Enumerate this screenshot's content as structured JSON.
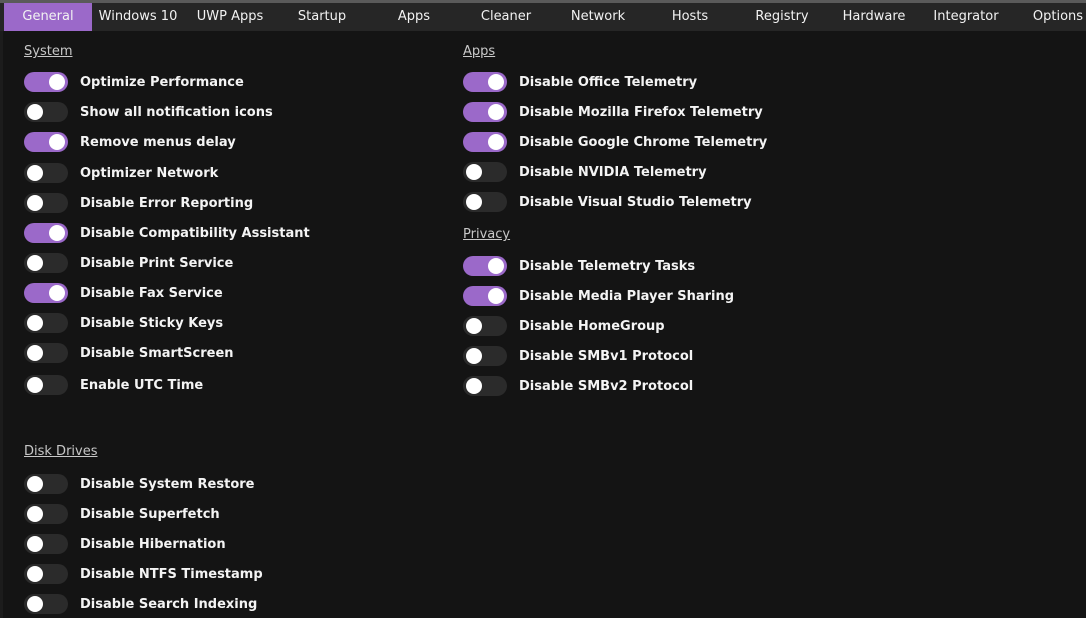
{
  "tabs": [
    {
      "label": "General",
      "active": true
    },
    {
      "label": "Windows 10"
    },
    {
      "label": "UWP Apps"
    },
    {
      "label": "Startup"
    },
    {
      "label": "Apps"
    },
    {
      "label": "Cleaner"
    },
    {
      "label": "Network"
    },
    {
      "label": "Hosts"
    },
    {
      "label": "Registry"
    },
    {
      "label": "Hardware"
    },
    {
      "label": "Integrator"
    },
    {
      "label": "Options"
    }
  ],
  "colors": {
    "accent": "#9b69c9",
    "track_off": "#2b2b2b",
    "background": "#141414"
  },
  "sections": {
    "system": {
      "title": "System",
      "items": [
        {
          "label": "Optimize Performance",
          "on": true
        },
        {
          "label": "Show all notification icons",
          "on": false
        },
        {
          "label": "Remove menus delay",
          "on": true
        },
        {
          "label": "Optimizer Network",
          "on": false
        },
        {
          "label": "Disable Error Reporting",
          "on": false
        },
        {
          "label": "Disable Compatibility Assistant",
          "on": true
        },
        {
          "label": "Disable Print Service",
          "on": false
        },
        {
          "label": "Disable Fax Service",
          "on": true
        },
        {
          "label": "Disable Sticky Keys",
          "on": false
        },
        {
          "label": "Disable SmartScreen",
          "on": false
        },
        {
          "label": "Enable UTC Time",
          "on": false
        }
      ]
    },
    "apps": {
      "title": "Apps",
      "items": [
        {
          "label": "Disable Office Telemetry",
          "on": true
        },
        {
          "label": "Disable Mozilla Firefox Telemetry",
          "on": true
        },
        {
          "label": "Disable Google Chrome Telemetry",
          "on": true
        },
        {
          "label": "Disable NVIDIA Telemetry",
          "on": false
        },
        {
          "label": "Disable Visual Studio Telemetry",
          "on": false
        }
      ]
    },
    "privacy": {
      "title": "Privacy",
      "items": [
        {
          "label": "Disable Telemetry Tasks",
          "on": true
        },
        {
          "label": "Disable Media Player Sharing",
          "on": true
        },
        {
          "label": "Disable HomeGroup",
          "on": false
        },
        {
          "label": "Disable SMBv1 Protocol",
          "on": false
        },
        {
          "label": "Disable SMBv2 Protocol",
          "on": false
        }
      ]
    },
    "disk": {
      "title": "Disk Drives",
      "items": [
        {
          "label": "Disable System Restore",
          "on": false
        },
        {
          "label": "Disable Superfetch",
          "on": false
        },
        {
          "label": "Disable Hibernation",
          "on": false
        },
        {
          "label": "Disable NTFS Timestamp",
          "on": false
        },
        {
          "label": "Disable Search Indexing",
          "on": false
        }
      ]
    }
  }
}
